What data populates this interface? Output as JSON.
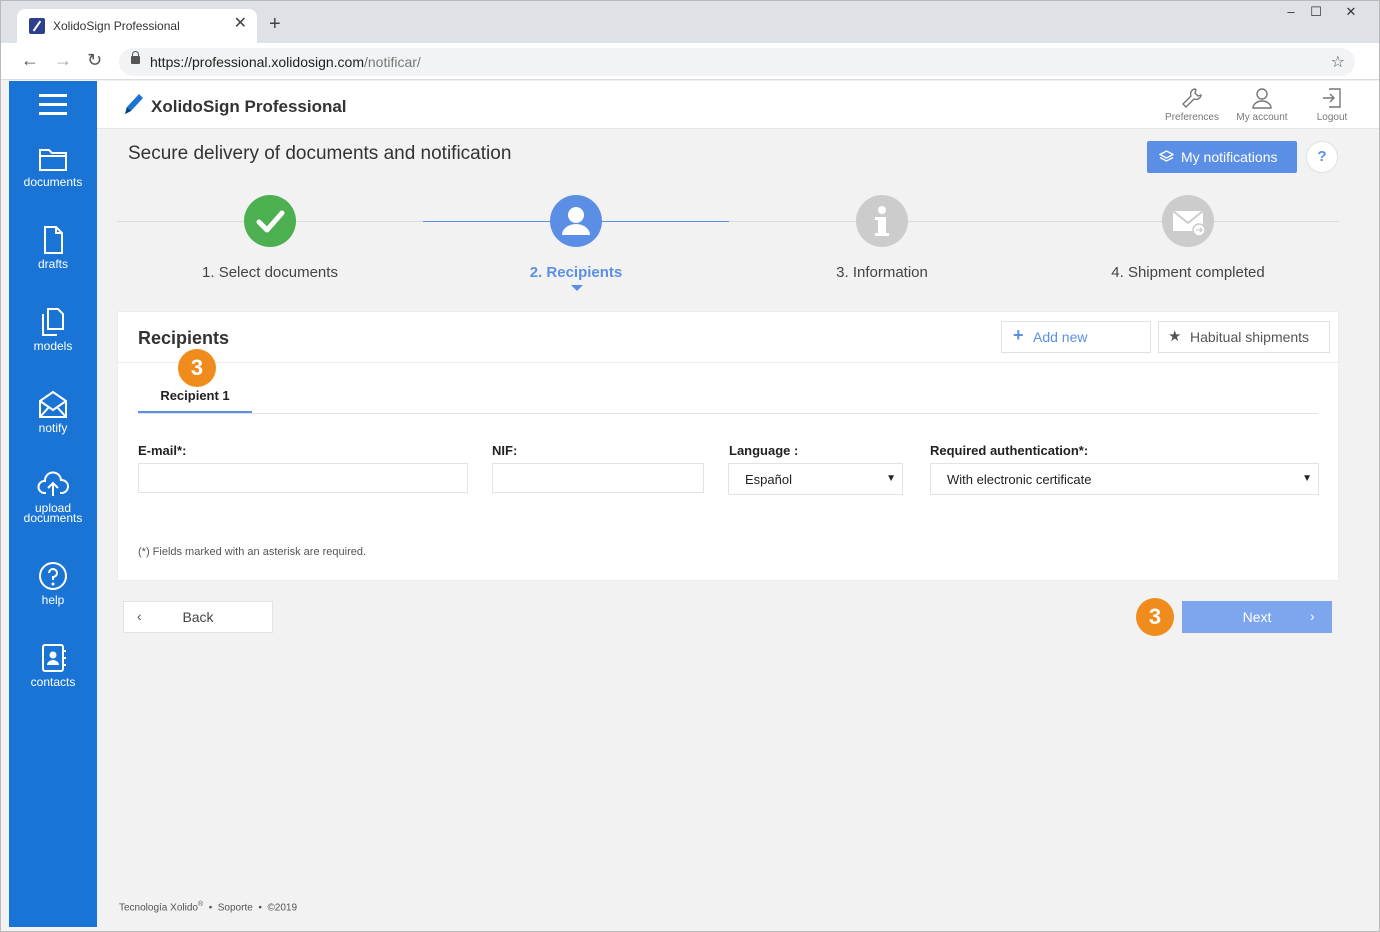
{
  "browser": {
    "tab_title": "XolidoSign Professional",
    "url_host": "https://professional.xolidosign.com",
    "url_path": "/notificar/"
  },
  "sidebar": {
    "items": [
      {
        "label": "documents",
        "icon": "folder-icon"
      },
      {
        "label": "drafts",
        "icon": "document-icon"
      },
      {
        "label": "models",
        "icon": "copy-documents-icon"
      },
      {
        "label": "notify",
        "icon": "envelope-icon"
      },
      {
        "label": "upload",
        "label2": "documents",
        "icon": "cloud-upload-icon"
      },
      {
        "label": "help",
        "icon": "question-circle-icon"
      },
      {
        "label": "contacts",
        "icon": "address-book-icon"
      }
    ]
  },
  "header": {
    "app_title": "XolidoSign Professional",
    "actions": [
      {
        "label": "Preferences",
        "icon": "wrench-icon"
      },
      {
        "label": "My account",
        "icon": "user-icon"
      },
      {
        "label": "Logout",
        "icon": "logout-icon"
      }
    ]
  },
  "page": {
    "title": "Secure delivery of documents and notification",
    "my_notifications": "My notifications",
    "help": "?"
  },
  "stepper": {
    "steps": [
      {
        "label": "1. Select documents",
        "state": "done",
        "color": "#4caf50"
      },
      {
        "label": "2. Recipients",
        "state": "active",
        "color": "#5b8fe6"
      },
      {
        "label": "3. Information",
        "state": "pending",
        "color": "#cccccc"
      },
      {
        "label": "4. Shipment completed",
        "state": "pending",
        "color": "#cccccc"
      }
    ]
  },
  "recipients": {
    "title": "Recipients",
    "add_new": "Add new",
    "habitual": "Habitual shipments",
    "badge": "3",
    "tab_label": "Recipient 1",
    "email_label": "E-mail*:",
    "email_value": "",
    "nif_label": "NIF:",
    "nif_value": "",
    "language_label": "Language :",
    "language_value": "Español",
    "auth_label": "Required authentication*:",
    "auth_value": "With electronic certificate",
    "required_note": "(*) Fields marked with an asterisk are required."
  },
  "nav": {
    "back": "Back",
    "next": "Next",
    "badge": "3"
  },
  "footer": {
    "company": "Tecnología Xolido",
    "reg": "®",
    "sep": "•",
    "support": "Soporte",
    "copyright": "©2019"
  },
  "colors": {
    "sidebar": "#1a74d6",
    "accent": "#5b8fe6",
    "badge": "#ef8c1c",
    "done": "#4caf50"
  }
}
